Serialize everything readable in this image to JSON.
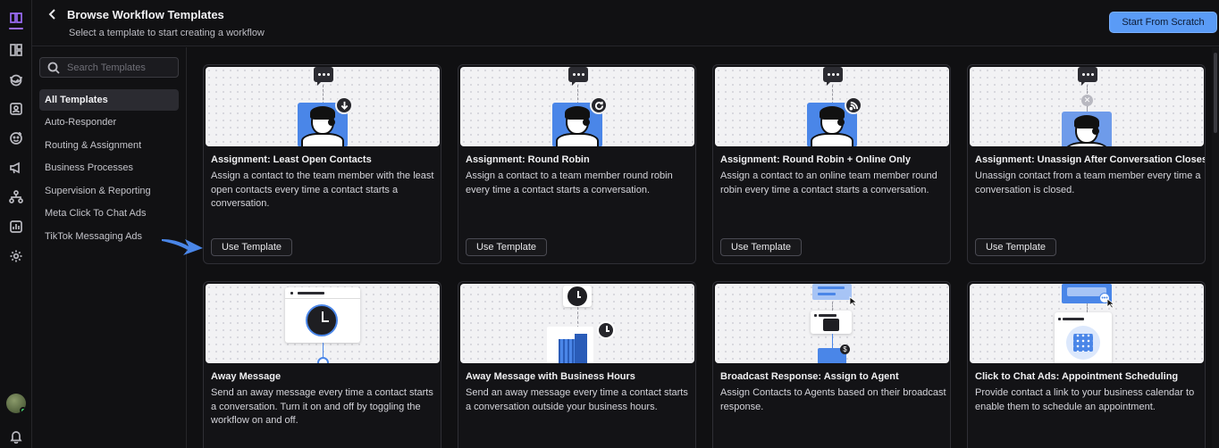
{
  "header": {
    "title": "Browse Workflow Templates",
    "subtitle": "Select a template to start creating a workflow",
    "primary_button": "Start From Scratch"
  },
  "sidebar": {
    "search_placeholder": "Search Templates",
    "categories": [
      {
        "label": "All Templates",
        "active": true
      },
      {
        "label": "Auto-Responder"
      },
      {
        "label": "Routing & Assignment"
      },
      {
        "label": "Business Processes"
      },
      {
        "label": "Supervision & Reporting"
      },
      {
        "label": "Meta Click To Chat Ads"
      },
      {
        "label": "TikTok Messaging Ads"
      }
    ]
  },
  "rail_icons": [
    "workflows-icon",
    "dashboard-icon",
    "inbox-icon",
    "contacts-icon",
    "broadcast-icon",
    "megaphone-icon",
    "org-chart-icon",
    "reports-icon",
    "settings-icon",
    "avatar",
    "bell-icon"
  ],
  "templates": [
    {
      "title": "Assignment: Least Open Contacts",
      "description": "Assign a contact to the team member with the least open contacts every time a contact starts a conversation.",
      "button": "Use Template"
    },
    {
      "title": "Assignment: Round Robin",
      "description": "Assign a contact to a team member round robin every time a contact starts a conversation.",
      "button": "Use Template"
    },
    {
      "title": "Assignment: Round Robin + Online Only",
      "description": "Assign a contact to an online team member round robin every time a contact starts a conversation.",
      "button": "Use Template"
    },
    {
      "title": "Assignment: Unassign After Conversation Closes",
      "description": "Unassign contact from a team member every time a conversation is closed.",
      "button": "Use Template"
    },
    {
      "title": "Away Message",
      "description": "Send an away message every time a contact starts a conversation. Turn it on and off by toggling the workflow on and off."
    },
    {
      "title": "Away Message with Business Hours",
      "description": "Send an away message every time a contact starts a conversation outside your business hours."
    },
    {
      "title": "Broadcast Response: Assign to Agent",
      "description": "Assign Contacts to Agents based on their broadcast response."
    },
    {
      "title": "Click to Chat Ads: Appointment Scheduling",
      "description": "Provide contact a link to your business calendar to enable them to schedule an appointment."
    }
  ],
  "colors": {
    "accent": "#5a9bf6",
    "brand_purple": "#9b6cf6",
    "illustration_blue": "#4a86e8",
    "online": "#3ecf6a"
  }
}
